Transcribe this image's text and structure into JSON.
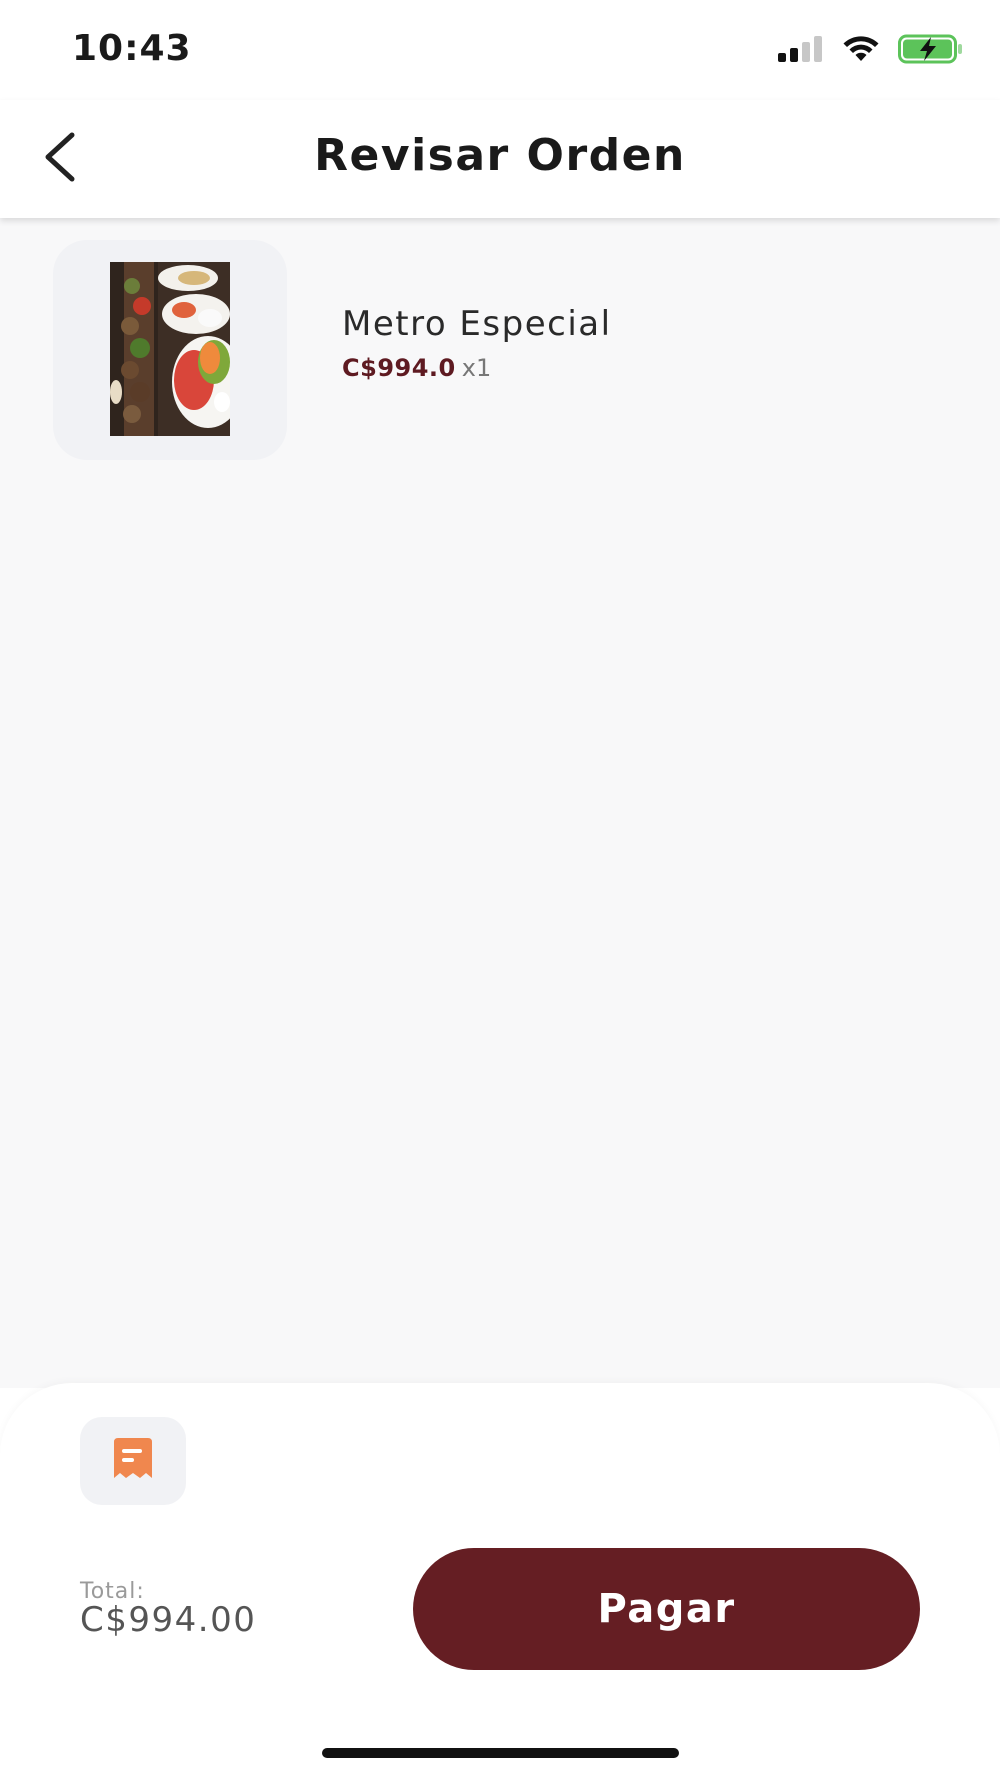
{
  "status_bar": {
    "time": "10:43",
    "icons": [
      "signal-icon",
      "wifi-icon",
      "battery-charging-icon"
    ]
  },
  "header": {
    "title": "Revisar Orden",
    "back_icon": "chevron-left-icon"
  },
  "order": {
    "items": [
      {
        "name": "Metro Especial",
        "price": "C$994.0",
        "quantity": "x1",
        "image": "food-photo"
      }
    ]
  },
  "summary": {
    "receipt_icon": "receipt-icon",
    "total_label": "Total:",
    "total_value": "C$994.00",
    "pay_label": "Pagar"
  },
  "colors": {
    "brand": "#651e23",
    "price_text": "#5e1a21",
    "receipt_icon": "#f0874e",
    "background": "#f8f8f9",
    "battery": "#5cc35a"
  }
}
